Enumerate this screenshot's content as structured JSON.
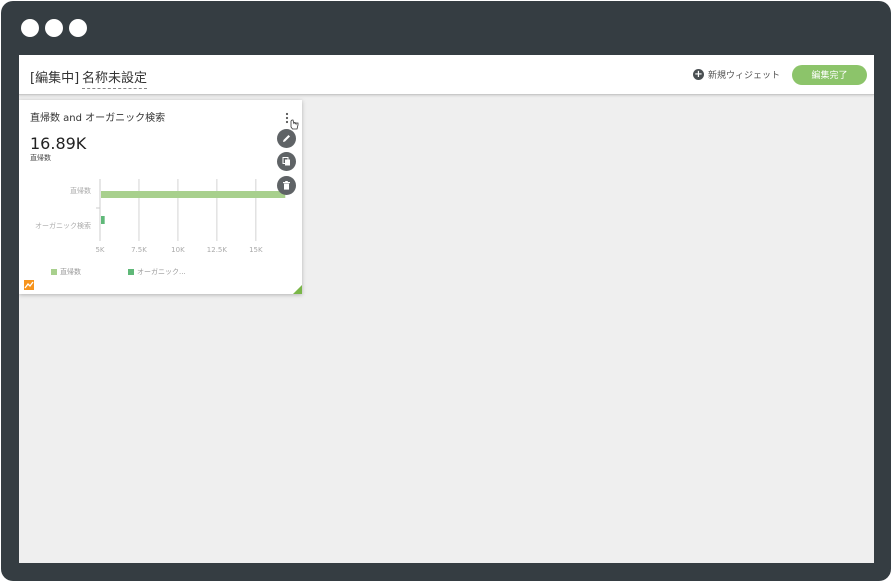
{
  "toolbar": {
    "edit_tag": "[編集中]",
    "dashboard_title": "名称未設定",
    "new_widget_label": "新規ウィジェット",
    "done_label": "編集完了"
  },
  "widget": {
    "title": "直帰数 and オーガニック検索",
    "metric_value": "16.89K",
    "metric_label": "直帰数",
    "icons": [
      "more-vertical-icon",
      "pencil-icon",
      "copy-icon",
      "trash-icon",
      "pointer-hand-icon"
    ],
    "legend": [
      {
        "label": "直帰数",
        "color": "#a8d08d"
      },
      {
        "label": "オーガニック...",
        "color": "#5fb878"
      }
    ]
  },
  "chart_data": {
    "type": "bar",
    "orientation": "horizontal",
    "categories": [
      "直帰数",
      "オーガニック検索"
    ],
    "values": [
      16890,
      5300
    ],
    "xlim": [
      5000,
      17000
    ],
    "xticks": [
      5000,
      7500,
      10000,
      12500,
      15000
    ],
    "xtick_labels": [
      "5K",
      "7.5K",
      "10K",
      "12.5K",
      "15K"
    ],
    "grid": true,
    "legend_position": "bottom-left",
    "colors": [
      "#a8d08d",
      "#5fb878"
    ]
  },
  "colors": {
    "frame": "#353d42",
    "canvas": "#efefef",
    "accent": "#8cc46a"
  }
}
